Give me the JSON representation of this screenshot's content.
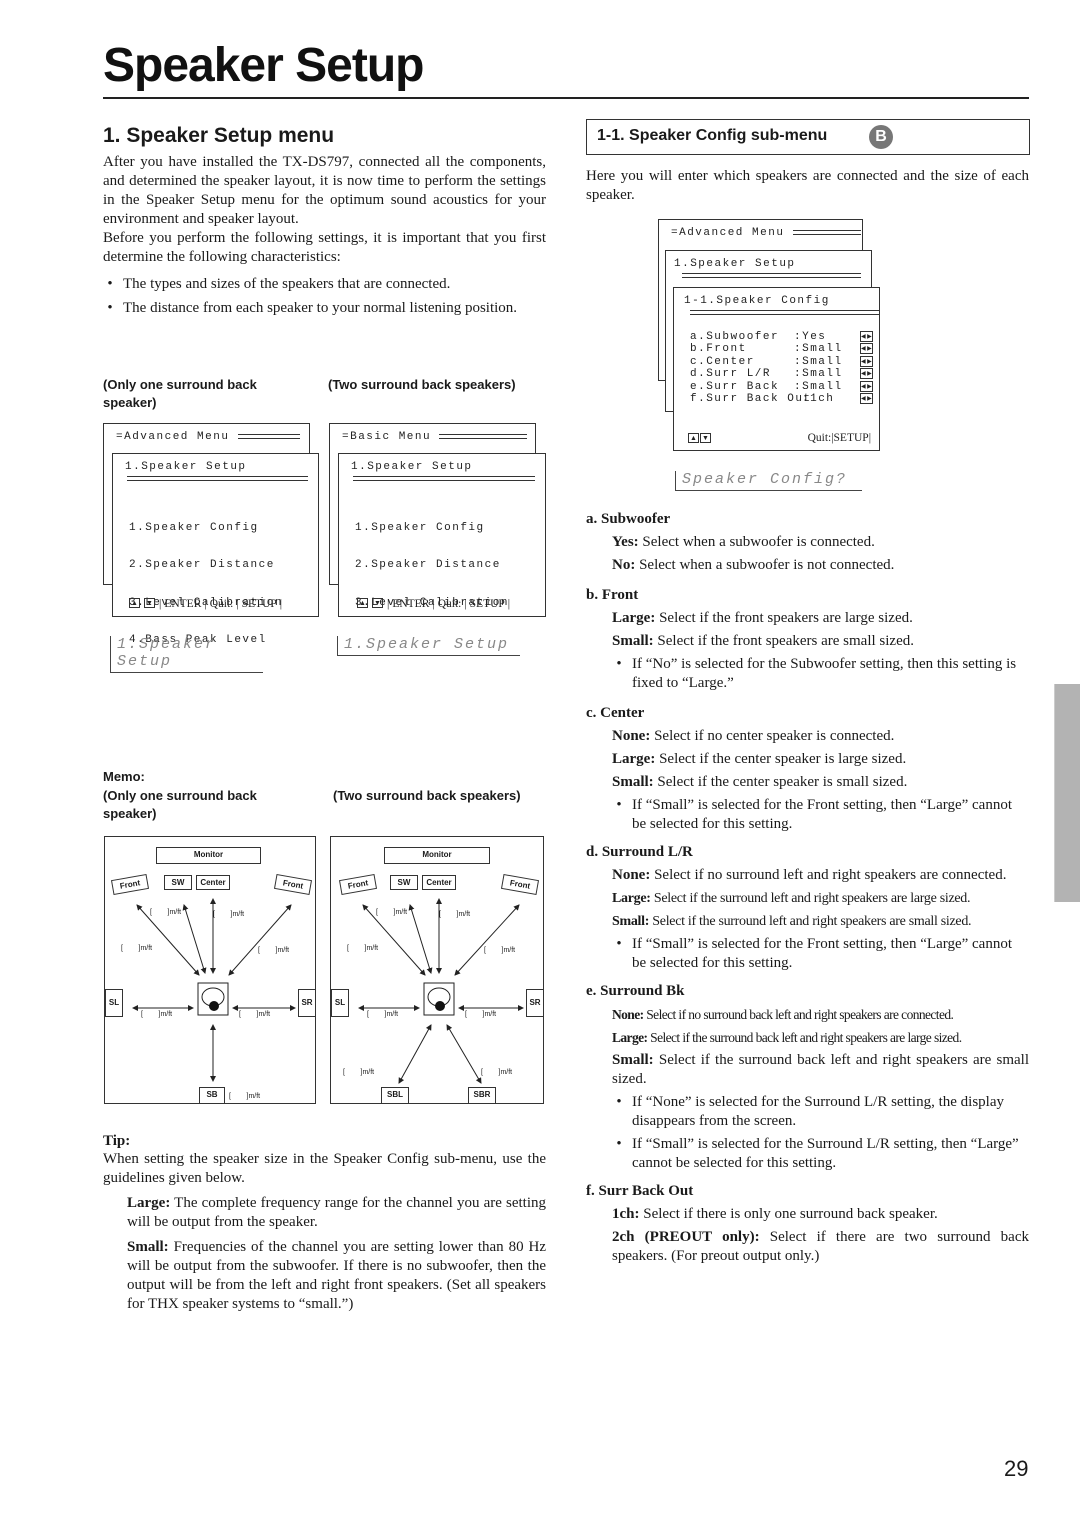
{
  "page": {
    "title": "Speaker Setup",
    "page_number": "29"
  },
  "left": {
    "section_title": "1. Speaker Setup menu",
    "intro_p1": "After you have installed the TX-DS797, connected all the components, and determined the speaker layout, it is now time to perform the settings in the Speaker Setup menu for the optimum sound acoustics for your environment and speaker layout.",
    "intro_p2": "Before you perform the following settings, it is important that you first determine the following characteristics:",
    "bullets": [
      "The types and sizes of the speakers that are connected.",
      "The distance from each speaker to your normal listening position."
    ],
    "caption_one": "(Only one surround back speaker)",
    "caption_two": "(Two surround back speakers)",
    "osd_one": {
      "back_title": "=Advanced Menu",
      "front_title": "1.Speaker Setup",
      "items": [
        "1.Speaker Config",
        "2.Speaker Distance",
        "3.Level Calibration",
        "4.Bass Peak Level"
      ],
      "nav": "ENTER",
      "quit": "Quit:",
      "setup": "SETUP",
      "lcd": "1.Speaker Setup"
    },
    "osd_two": {
      "back_title": "=Basic Menu",
      "front_title": "1.Speaker Setup",
      "items": [
        "1.Speaker Config",
        "2.Speaker Distance",
        "3.Level Calibration"
      ],
      "nav": "ENTER",
      "quit": "Quit:",
      "setup": "SETUP",
      "lcd": "1.Speaker Setup"
    },
    "memo_label": "Memo:",
    "memo_caption_one": "(Only one surround back speaker)",
    "memo_caption_two": "(Two surround back speakers)",
    "diagram_labels": {
      "monitor": "Monitor",
      "front": "Front",
      "sw": "SW",
      "center": "Center",
      "sl": "SL",
      "sr": "SR",
      "sb": "SB",
      "sbl": "SBL",
      "sbr": "SBR",
      "unit": "[        ]m/ft"
    },
    "tip_label": "Tip:",
    "tip_text": "When setting the speaker size in the Speaker Config sub-menu, use the guidelines given below.",
    "tip_large_label": "Large:",
    "tip_large_text": " The complete frequency range for the channel you are setting will be output from the speaker.",
    "tip_small_label": "Small:",
    "tip_small_text": " Frequencies of the channel you are setting lower than 80 Hz will be output from the subwoofer. If there is no subwoofer, then the output will be from the left and right front speakers. (Set all speakers for THX speaker systems to “small.”)"
  },
  "right": {
    "section_title": "1-1. Speaker Config sub-menu",
    "badge": "B",
    "intro": "Here you will enter which speakers are connected and the size of each speaker.",
    "osd": {
      "back_title": "=Advanced Menu",
      "mid_title": "1.Speaker Setup",
      "front_title": "1-1.Speaker Config",
      "rows": [
        {
          "label": "a.Subwoofer",
          "value": ":Yes"
        },
        {
          "label": "b.Front",
          "value": ":Small"
        },
        {
          "label": "c.Center",
          "value": ":Small"
        },
        {
          "label": "d.Surr L/R",
          "value": ":Small"
        },
        {
          "label": "e.Surr Back",
          "value": ":Small"
        },
        {
          "label": "f.Surr Back Out",
          "value": ":1ch"
        }
      ],
      "quit": "Quit:",
      "setup": "SETUP",
      "lcd": "Speaker Config?"
    },
    "sections": [
      {
        "heading": "a. Subwoofer",
        "options": [
          {
            "label": "Yes:",
            "text": " Select when a subwoofer is connected."
          },
          {
            "label": "No:",
            "text": " Select when a subwoofer is not connected."
          }
        ],
        "notes": []
      },
      {
        "heading": "b. Front",
        "options": [
          {
            "label": "Large:",
            "text": " Select if the front speakers are large sized."
          },
          {
            "label": "Small:",
            "text": " Select if the front speakers are small sized."
          }
        ],
        "notes": [
          "If “No” is selected for the Subwoofer setting, then this setting is fixed to “Large.”"
        ]
      },
      {
        "heading": "c. Center",
        "options": [
          {
            "label": "None:",
            "text": " Select if no center speaker is connected."
          },
          {
            "label": "Large:",
            "text": " Select if the center speaker is large sized."
          },
          {
            "label": "Small:",
            "text": " Select if the center speaker is small sized."
          }
        ],
        "notes": [
          "If “Small” is selected for the Front setting, then “Large” cannot be selected for this setting."
        ]
      },
      {
        "heading": "d. Surround L/R",
        "options": [
          {
            "label": "None:",
            "text": " Select if no surround left and right speakers are connected."
          },
          {
            "label": "Large:",
            "text": " Select if the surround left and right speakers are large sized."
          },
          {
            "label": "Small:",
            "text": " Select if the surround left and right speakers are small sized."
          }
        ],
        "notes": [
          "If “Small” is selected for the Front setting, then “Large” cannot be selected for this setting."
        ]
      },
      {
        "heading": "e. Surround Bk",
        "options": [
          {
            "label": "None:",
            "text": " Select if no surround back left and right speakers are connected."
          },
          {
            "label": "Large:",
            "text": " Select if the surround back left and right speakers are large sized."
          },
          {
            "label": "Small:",
            "text": " Select if the surround back left and right speakers are small sized."
          }
        ],
        "notes": [
          "If “None” is selected for the Surround L/R setting, the display disappears from the screen.",
          "If “Small” is selected for the Surround L/R setting, then “Large” cannot be selected for this setting."
        ]
      },
      {
        "heading": "f. Surr Back Out",
        "options": [
          {
            "label": "1ch:",
            "text": " Select if there is only one surround back speaker."
          },
          {
            "label": "2ch (PREOUT only):",
            "text": " Select if there are two surround back speakers. (For preout output only.)"
          }
        ],
        "notes": []
      }
    ]
  }
}
